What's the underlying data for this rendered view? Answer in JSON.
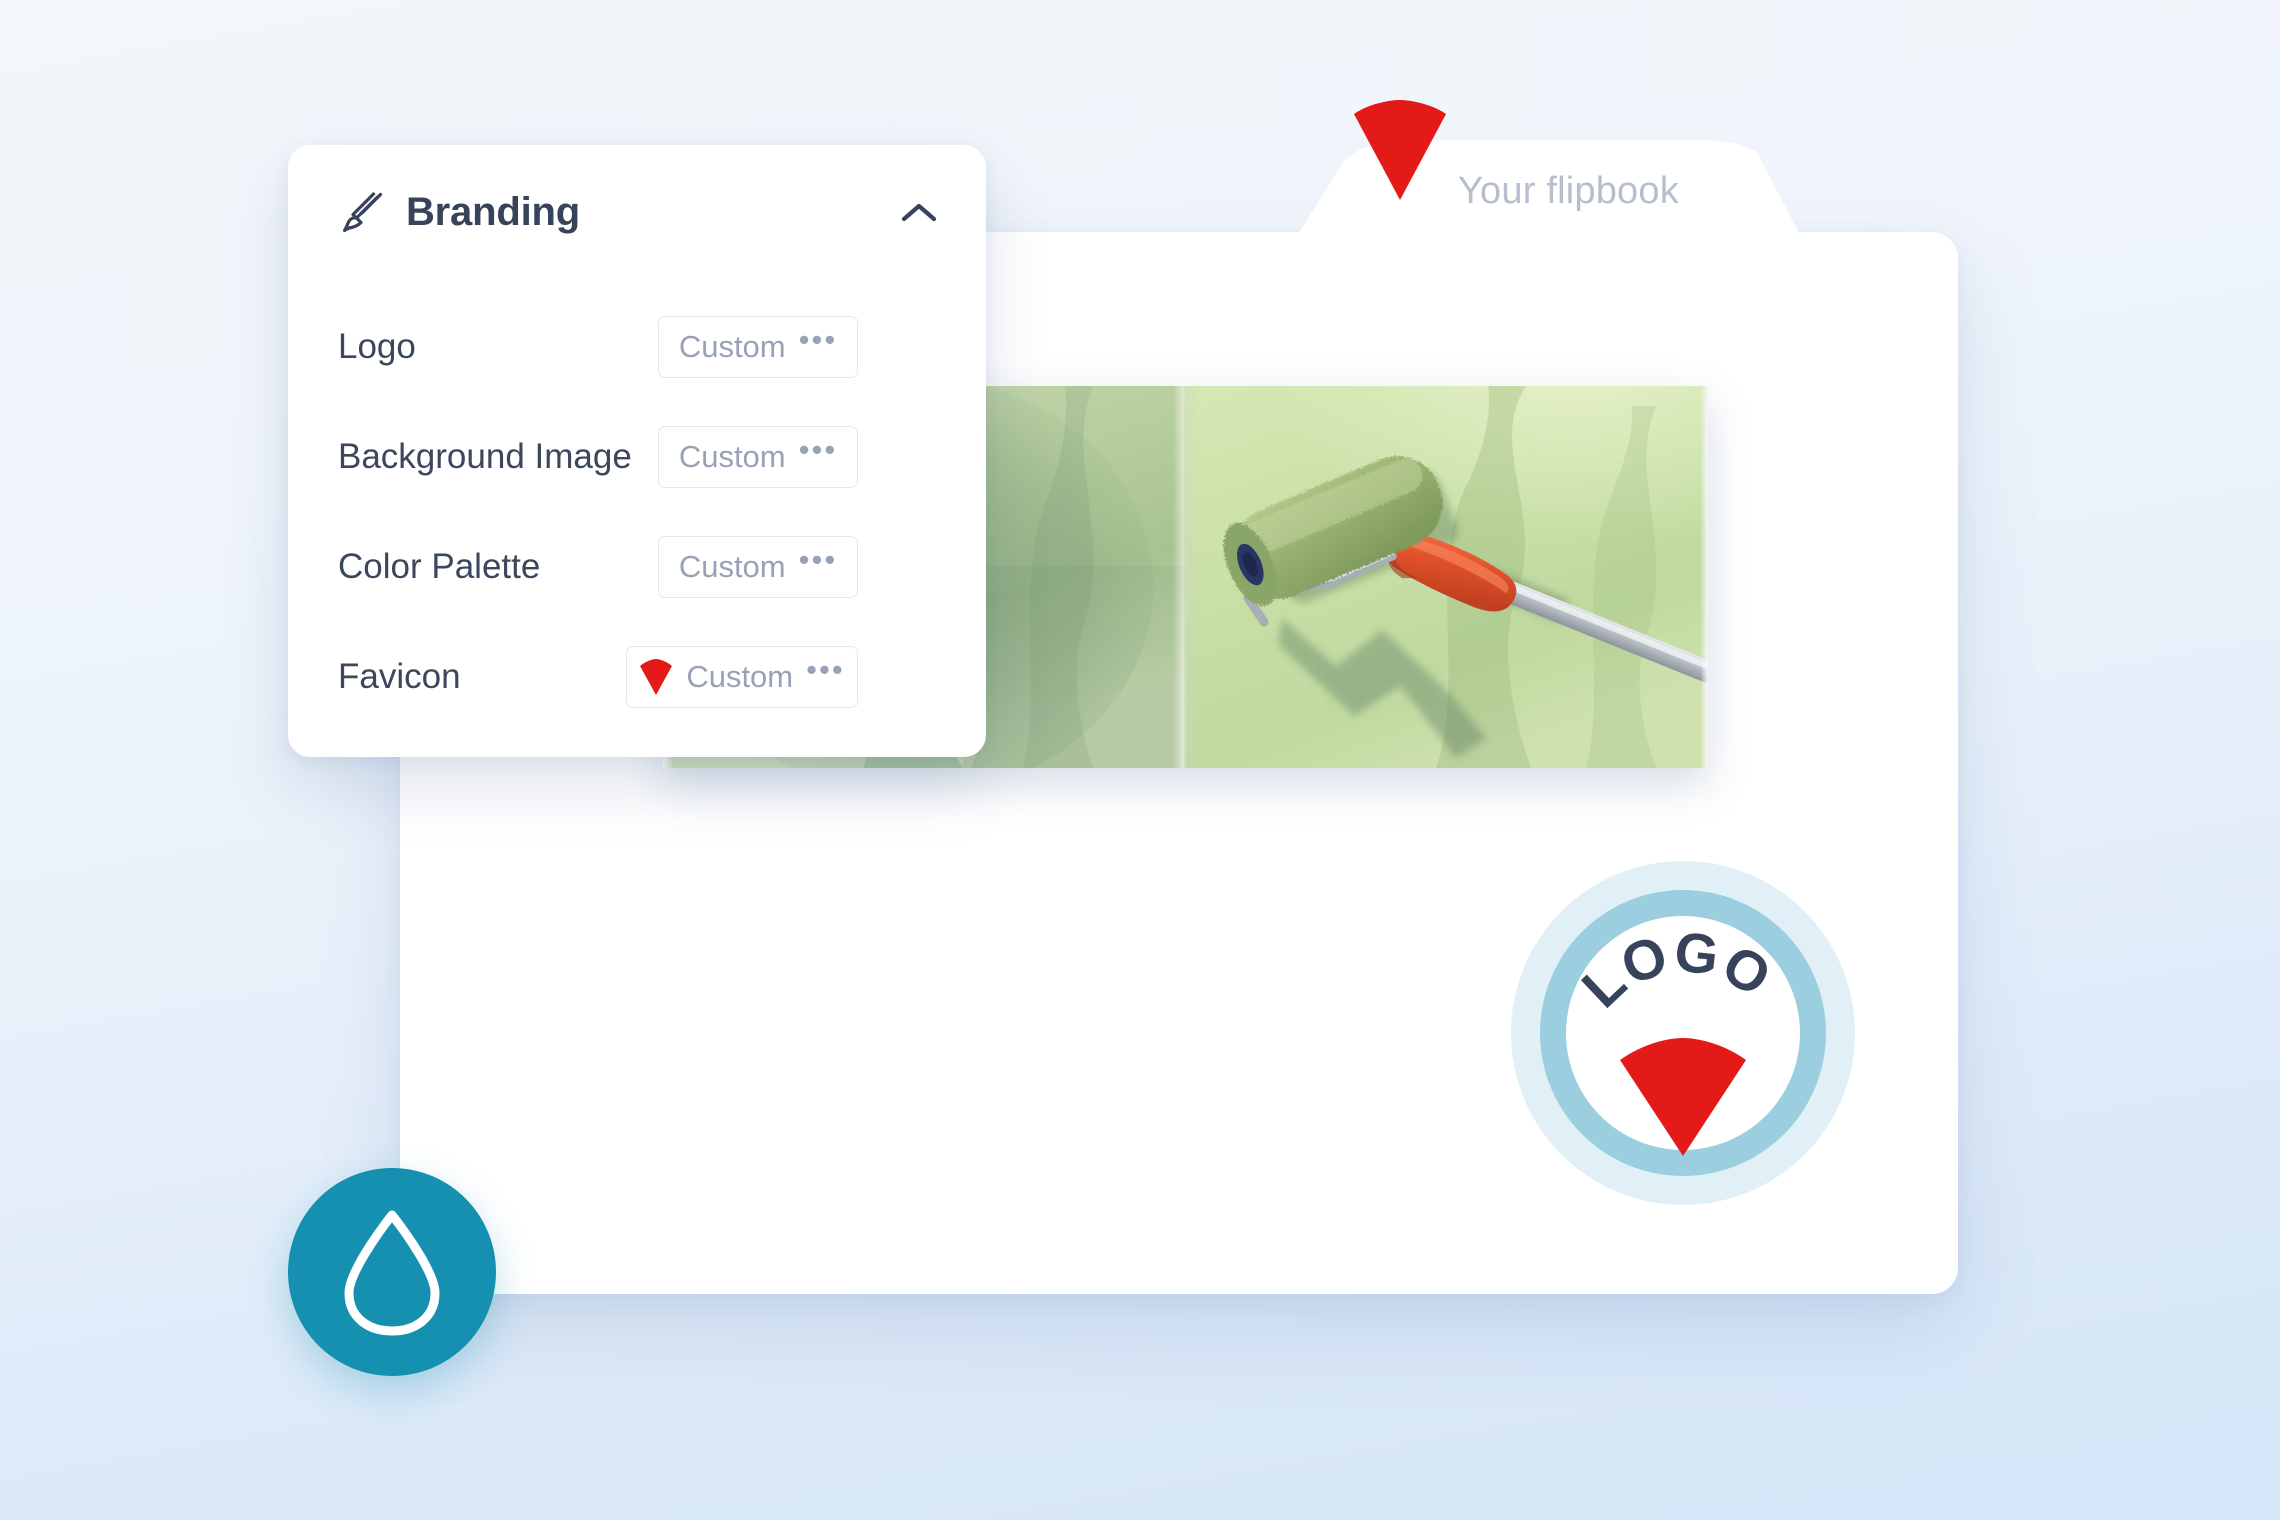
{
  "meta": {
    "scene": "flipbook-branding-customization"
  },
  "colors": {
    "brand_red": "#e31a17",
    "teal": "#1690b0",
    "ring_outer": "#cfe6f2",
    "ring_inner": "#7fc0d4",
    "panel_text": "#36435a",
    "muted_text": "#98a2b6",
    "tab_text": "#b6bfce",
    "background_top": "#f3f6fb",
    "background_bottom": "#d6e6f8"
  },
  "panel": {
    "title": "Branding",
    "icon": "paint-brush-icon",
    "collapse_icon": "chevron-up-icon",
    "rows": [
      {
        "label": "Logo",
        "value": "Custom",
        "dots": "•••",
        "has_preview": false
      },
      {
        "label": "Background Image",
        "value": "Custom",
        "dots": "•••",
        "has_preview": false
      },
      {
        "label": "Color Palette",
        "value": "Custom",
        "dots": "•••",
        "has_preview": false
      },
      {
        "label": "Favicon",
        "value": "Custom",
        "dots": "•••",
        "has_preview": true
      }
    ]
  },
  "browser": {
    "tab_label": "Your flipbook",
    "tab_favicon": "red-wedge-favicon"
  },
  "flipbook": {
    "page_image_alt": "green paint roller with orange handle painting a green wall",
    "spread_pages": 2
  },
  "logo_badge": {
    "text": "LOGO",
    "mark": "red-wedge-mark"
  },
  "droplet": {
    "icon": "water-droplet-icon"
  }
}
